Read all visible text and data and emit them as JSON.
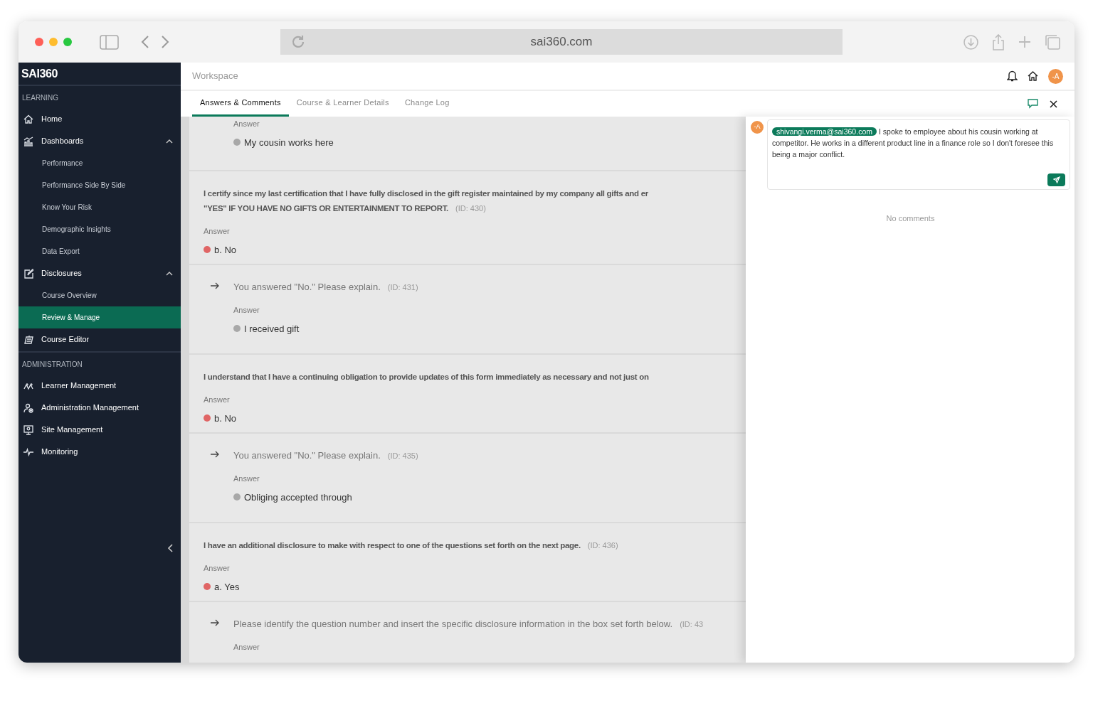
{
  "browser": {
    "url": "sai360.com"
  },
  "sidebar": {
    "logo": "SAI360",
    "sections": [
      {
        "title": "LEARNING",
        "items": [
          {
            "label": "Home",
            "selected": false
          },
          {
            "label": "Dashboards",
            "selected": false,
            "expanded": true,
            "children": [
              {
                "label": "Performance",
                "selected": false
              },
              {
                "label": "Performance Side By Side",
                "selected": false
              },
              {
                "label": "Know Your Risk",
                "selected": false
              },
              {
                "label": "Demographic Insights",
                "selected": false
              },
              {
                "label": "Data Export",
                "selected": false
              }
            ]
          },
          {
            "label": "Disclosures",
            "selected": false,
            "expanded": true,
            "children": [
              {
                "label": "Course Overview",
                "selected": false
              },
              {
                "label": "Review & Manage",
                "selected": true
              }
            ]
          },
          {
            "label": "Course Editor",
            "selected": false
          }
        ]
      },
      {
        "title": "ADMINISTRATION",
        "items": [
          {
            "label": "Learner Management",
            "selected": false
          },
          {
            "label": "Administration Management",
            "selected": false
          },
          {
            "label": "Site Management",
            "selected": false
          },
          {
            "label": "Monitoring",
            "selected": false
          }
        ]
      }
    ]
  },
  "header": {
    "title": "Workspace",
    "avatar": "-A"
  },
  "tabs": [
    {
      "label": "Answers & Comments",
      "selected": true
    },
    {
      "label": "Course & Learner Details",
      "selected": false
    },
    {
      "label": "Change Log",
      "selected": false
    }
  ],
  "entries": [
    {
      "kind": "followup",
      "answer_label": "Answer",
      "answer": "My cousin works here",
      "color": "#a8a8a8"
    },
    {
      "kind": "question",
      "lines": [
        "I certify since my last certification that I have fully disclosed in the gift register maintained by my company all gifts and er",
        "\"YES\" IF YOU HAVE NO GIFTS OR ENTERTAINMENT TO REPORT."
      ],
      "id": "(ID: 430)",
      "answer_label": "Answer",
      "answer": "b. No",
      "color": "#e06565"
    },
    {
      "kind": "followup",
      "lines": [
        "You answered \"No.\" Please explain."
      ],
      "id": "(ID: 431)",
      "answer_label": "Answer",
      "answer": "I received gift",
      "color": "#a8a8a8"
    },
    {
      "kind": "question",
      "lines": [
        "I understand that I have a continuing obligation to provide updates of this form immediately as necessary and not just on"
      ],
      "answer_label": "Answer",
      "answer": "b. No",
      "color": "#e06565"
    },
    {
      "kind": "followup",
      "lines": [
        "You answered \"No.\" Please explain."
      ],
      "id": "(ID: 435)",
      "answer_label": "Answer",
      "answer": "Obliging accepted through",
      "color": "#a8a8a8"
    },
    {
      "kind": "question",
      "lines": [
        "I have an additional disclosure to make with respect to one of the questions set forth on the next page."
      ],
      "id": "(ID: 436)",
      "answer_label": "Answer",
      "answer": "a. Yes",
      "color": "#e06565"
    },
    {
      "kind": "followup",
      "lines": [
        "Please identify the question number and insert the specific disclosure information in the box set forth below."
      ],
      "id": "(ID: 43",
      "answer_label": "Answer"
    }
  ],
  "comments": {
    "items": [
      {
        "avatar": "-A",
        "mention": "shivangi.verma@sai360.com",
        "text": "I spoke to employee about his cousin working at competitor. He works in a different product line in a finance role so I don't foresee this being a major conflict."
      }
    ],
    "empty": "No comments"
  }
}
